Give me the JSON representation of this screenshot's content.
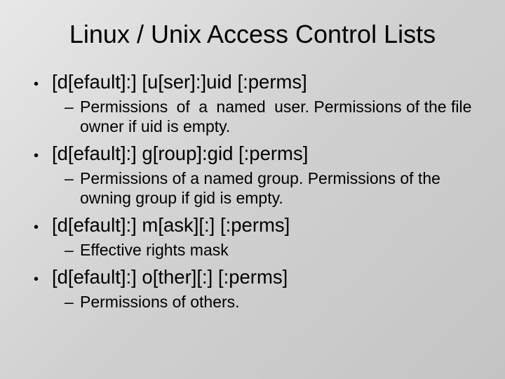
{
  "title": "Linux / Unix Access Control Lists",
  "items": [
    {
      "syntax": "[d[efault]:] [u[ser]:]uid [:perms]",
      "desc_a": "Permissions  of  a  named user.",
      "desc_b": " Permissions of the file owner if uid is empty."
    },
    {
      "syntax": "[d[efault]:] g[roup]:gid [:perms]",
      "desc_a": "Permissions of a named group. Permissions of the owning group if gid is empty.",
      "desc_b": ""
    },
    {
      "syntax": "[d[efault]:] m[ask][:] [:perms]",
      "desc_a": "Effective rights mask",
      "desc_b": ""
    },
    {
      "syntax": "[d[efault]:] o[ther][:] [:perms]",
      "desc_a": "Permissions of others.",
      "desc_b": ""
    }
  ]
}
